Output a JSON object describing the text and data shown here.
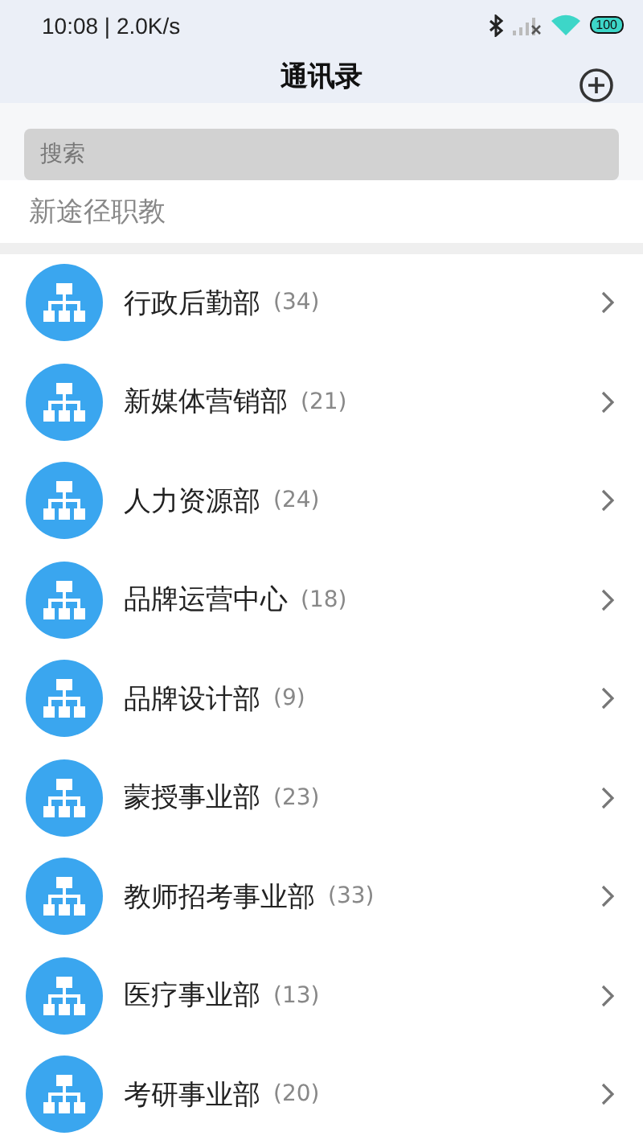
{
  "status_bar": {
    "time": "10:08 | 2.0K/s",
    "battery": "100"
  },
  "header": {
    "title": "通讯录"
  },
  "search": {
    "placeholder": "搜索"
  },
  "organization": {
    "name": "新途径职教"
  },
  "departments": [
    {
      "name": "行政后勤部",
      "count": "(34)"
    },
    {
      "name": "新媒体营销部",
      "count": "(21)"
    },
    {
      "name": "人力资源部",
      "count": "(24)"
    },
    {
      "name": "品牌运营中心",
      "count": "(18)"
    },
    {
      "name": "品牌设计部",
      "count": "(9)"
    },
    {
      "name": "蒙授事业部",
      "count": "(23)"
    },
    {
      "name": "教师招考事业部",
      "count": "(33)"
    },
    {
      "name": "医疗事业部",
      "count": "(13)"
    },
    {
      "name": "考研事业部",
      "count": "(20)"
    }
  ]
}
